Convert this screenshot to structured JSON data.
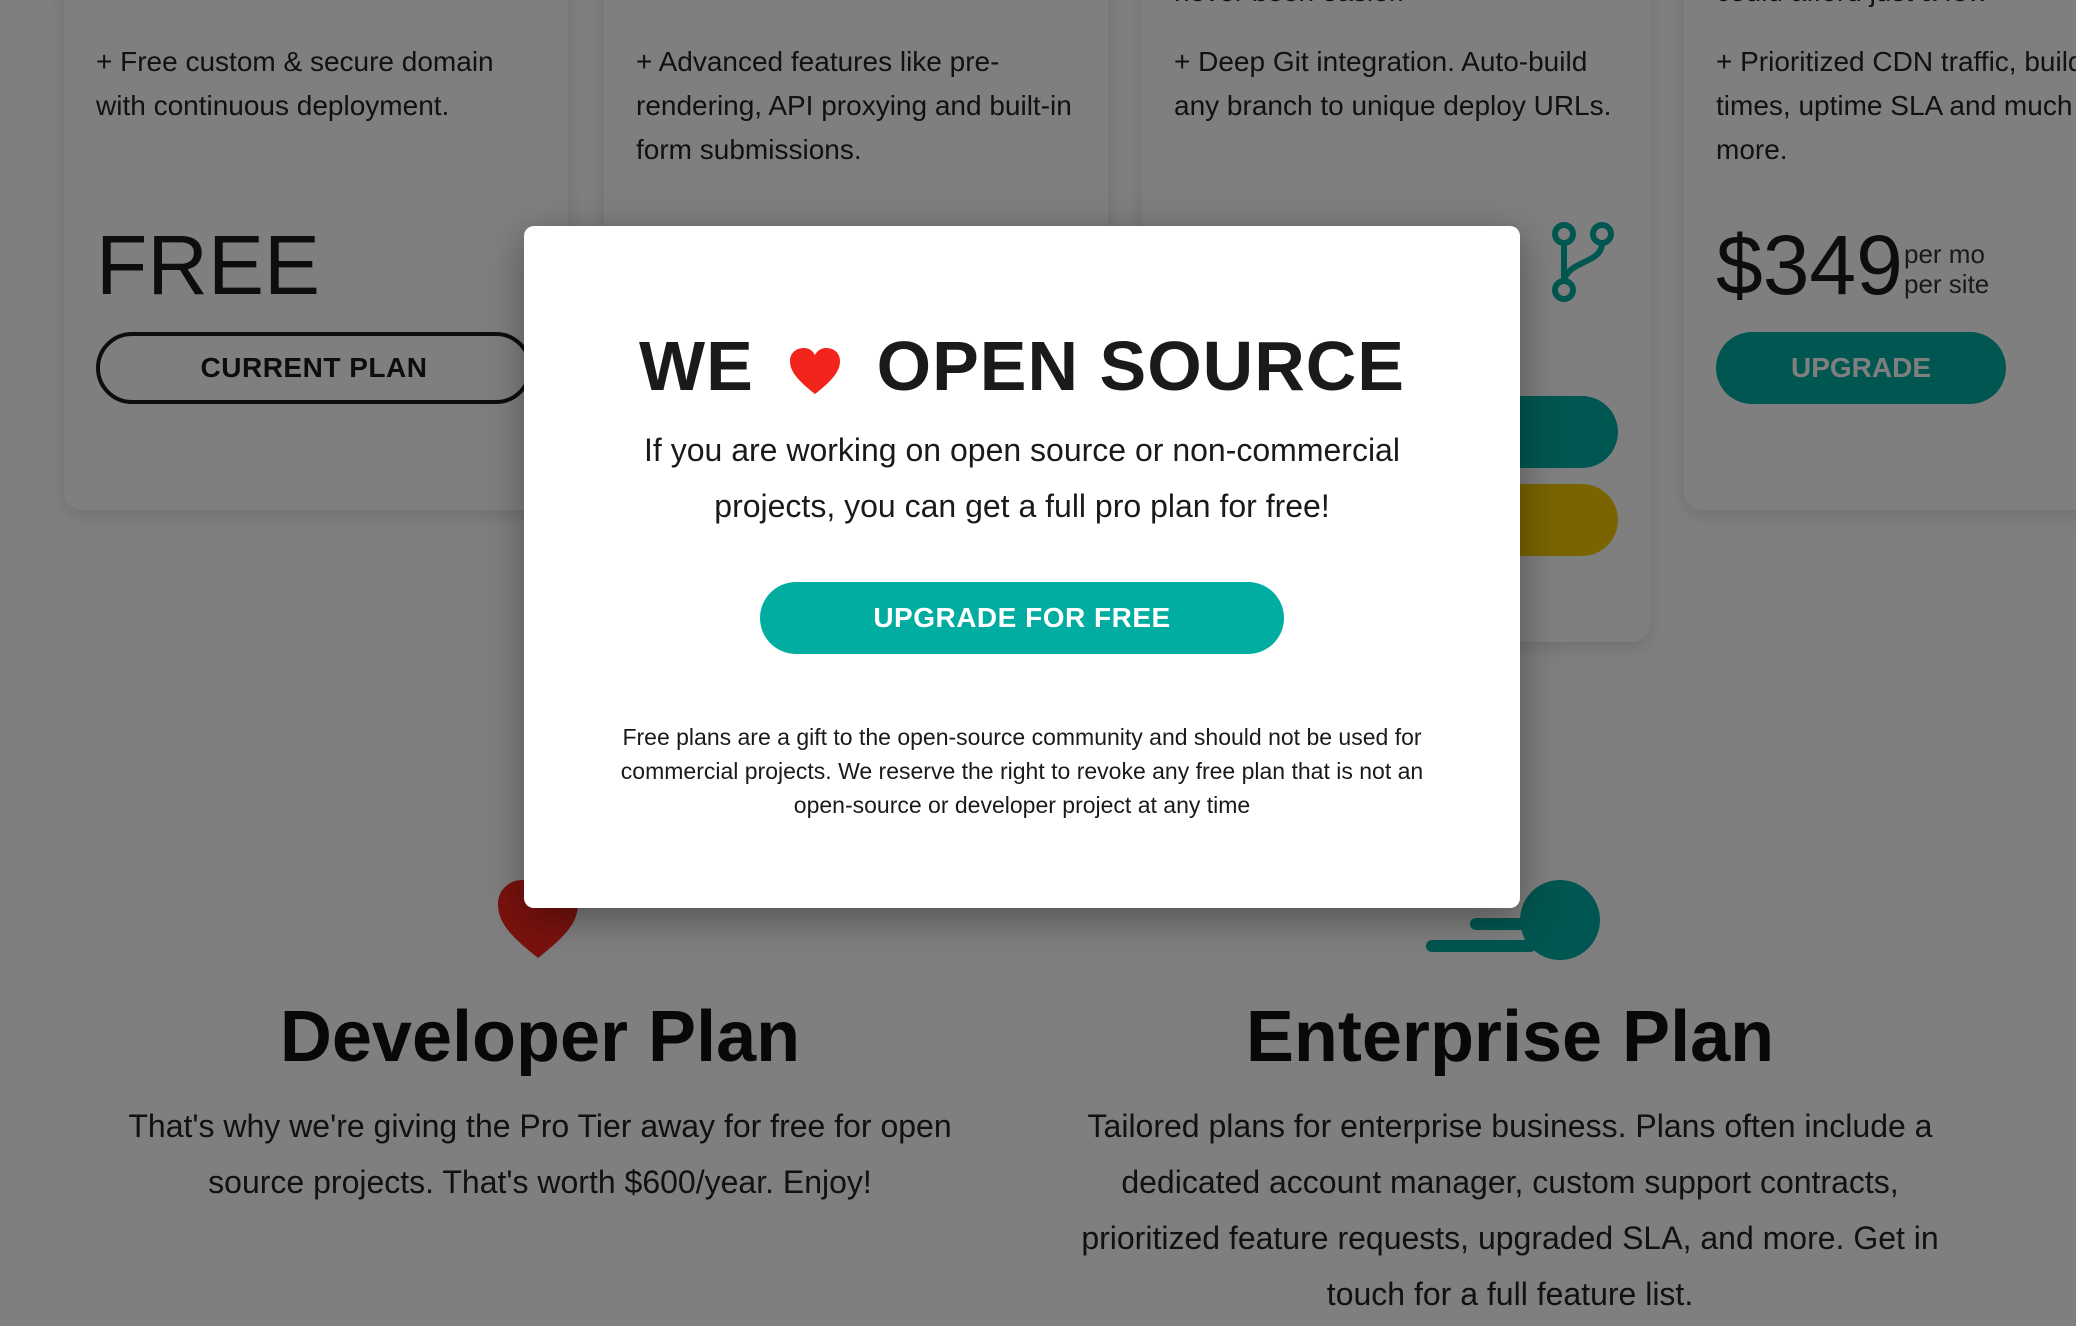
{
  "cards": [
    {
      "desc": "+ Free custom & secure domain with continuous deployment.",
      "price": "FREE",
      "button": "CURRENT PLAN"
    },
    {
      "desc": "+ Advanced features like pre-rendering, API proxying and built-in form submissions."
    },
    {
      "desc_top": "never been easier.",
      "desc": "+ Deep Git integration. Auto-build any branch to unique deploy URLs."
    },
    {
      "desc_top": "could afford just a few",
      "desc": "+ Prioritized CDN traffic, build times, uptime SLA and much more.",
      "price": "$349",
      "per_line1": "per mo",
      "per_line2": "per site",
      "button": "UPGRADE"
    }
  ],
  "developer": {
    "title": "Developer Plan",
    "text": "That's why we're giving the Pro Tier away for free for open source projects. That's worth $600/year. Enjoy!"
  },
  "enterprise": {
    "title": "Enterprise Plan",
    "text": "Tailored plans for enterprise business. Plans often include a dedicated account manager, custom support contracts, prioritized feature requests, upgraded SLA, and more. Get in touch for a full feature list."
  },
  "modal": {
    "title_left": "WE",
    "title_right": "OPEN SOURCE",
    "lead": "If you are working on open source or non-commercial projects, you can get a full pro plan for free!",
    "button": "UPGRADE FOR FREE",
    "fine_print": "Free plans are a gift to the open-source community and should not be used for commercial projects. We reserve the right to revoke any free plan that is not an open-source or developer project at any time"
  },
  "colors": {
    "teal": "#00ada0",
    "yellow": "#f2c800",
    "red": "#f2241c"
  },
  "icons": [
    "heart-icon",
    "git-branch-icon",
    "enterprise-icon"
  ]
}
